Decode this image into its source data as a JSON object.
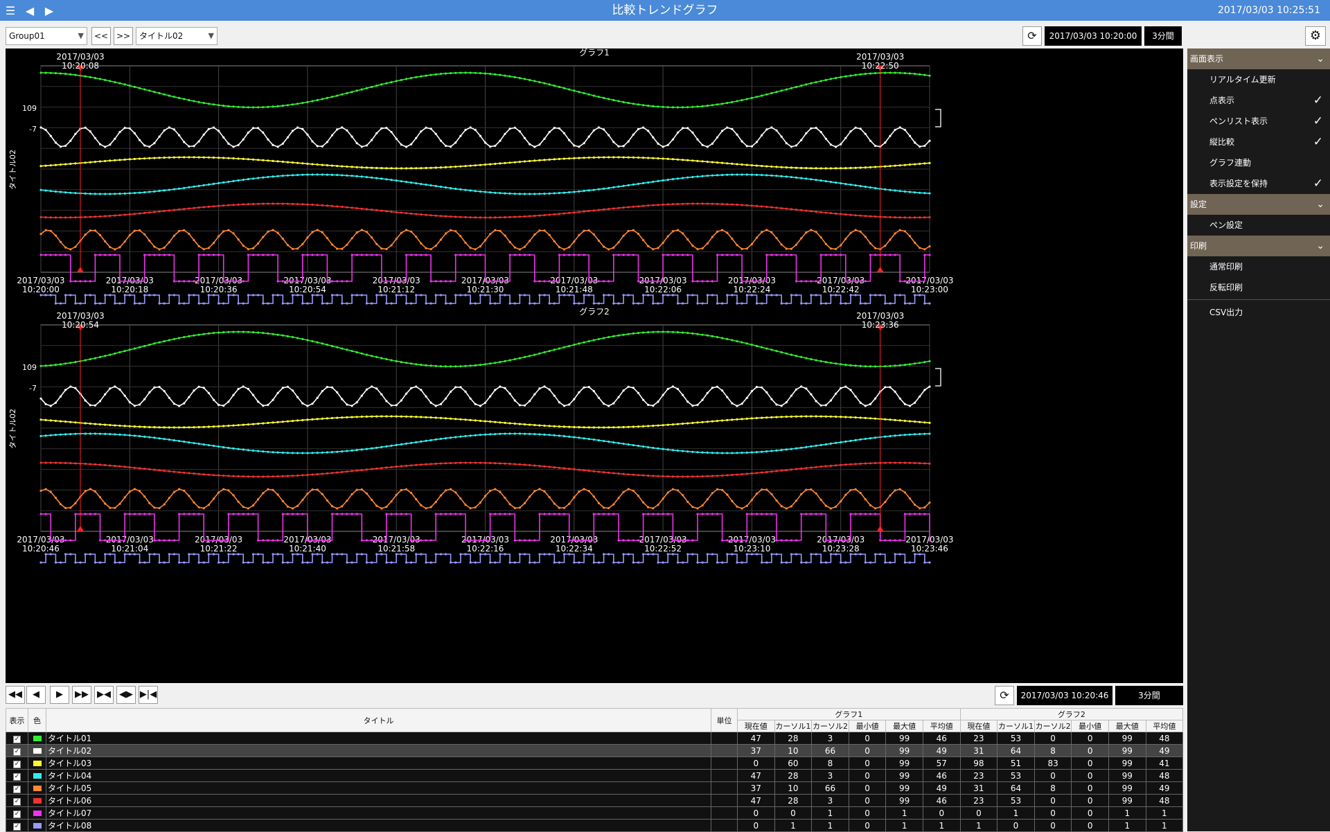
{
  "app": {
    "title": "比較トレンドグラフ",
    "clock": "2017/03/03 10:25:51"
  },
  "toolbar": {
    "group": "Group01",
    "prev": "<<",
    "next": ">>",
    "title_select": "タイトル02",
    "datetime": "2017/03/03 10:20:00",
    "span": "3分間"
  },
  "bottom": {
    "datetime": "2017/03/03 10:20:46",
    "span": "3分間"
  },
  "panel": {
    "sections": [
      {
        "label": "画面表示",
        "items": [
          {
            "label": "リアルタイム更新",
            "checked": false
          },
          {
            "label": "点表示",
            "checked": true
          },
          {
            "label": "ペンリスト表示",
            "checked": true
          },
          {
            "label": "縦比較",
            "checked": true
          },
          {
            "label": "グラフ連動",
            "checked": false
          },
          {
            "label": "表示設定を保持",
            "checked": true
          }
        ]
      },
      {
        "label": "設定",
        "items": [
          {
            "label": "ペン設定",
            "checked": false
          }
        ]
      },
      {
        "label": "印刷",
        "items": [
          {
            "label": "通常印刷",
            "checked": false
          },
          {
            "label": "反転印刷",
            "checked": false
          }
        ]
      }
    ],
    "csv": "CSV出力",
    "check_mark": "✓",
    "chevron": "⌄"
  },
  "chart_data": [
    {
      "type": "line",
      "title": "グラフ1",
      "ylabel": "タイトル02",
      "y_ticks": [
        "109",
        "-7"
      ],
      "x_ticks": [
        "2017/03/03|10:20:00",
        "2017/03/03|10:20:18",
        "2017/03/03|10:20:36",
        "2017/03/03|10:20:54",
        "2017/03/03|10:21:12",
        "2017/03/03|10:21:30",
        "2017/03/03|10:21:48",
        "2017/03/03|10:22:06",
        "2017/03/03|10:22:24",
        "2017/03/03|10:22:42",
        "2017/03/03|10:23:00"
      ],
      "cursors": [
        {
          "label": "2017/03/03|10:20:08",
          "t": 8
        },
        {
          "label": "2017/03/03|10:22:50",
          "t": 170
        }
      ],
      "x_range_seconds": [
        0,
        180
      ],
      "phase": 0
    },
    {
      "type": "line",
      "title": "グラフ2",
      "ylabel": "タイトル02",
      "y_ticks": [
        "109",
        "-7"
      ],
      "x_ticks": [
        "2017/03/03|10:20:46",
        "2017/03/03|10:21:04",
        "2017/03/03|10:21:22",
        "2017/03/03|10:21:40",
        "2017/03/03|10:21:58",
        "2017/03/03|10:22:16",
        "2017/03/03|10:22:34",
        "2017/03/03|10:22:52",
        "2017/03/03|10:23:10",
        "2017/03/03|10:23:28",
        "2017/03/03|10:23:46"
      ],
      "cursors": [
        {
          "label": "2017/03/03|10:20:54",
          "t": 8
        },
        {
          "label": "2017/03/03|10:23:36",
          "t": 170
        }
      ],
      "x_range_seconds": [
        0,
        180
      ],
      "phase": 46
    }
  ],
  "pens": [
    {
      "name": "タイトル01",
      "color": "#33ee33",
      "g1": [
        "47",
        "28",
        "3",
        "0",
        "99",
        "46"
      ],
      "g2": [
        "23",
        "53",
        "0",
        "0",
        "99",
        "48"
      ]
    },
    {
      "name": "タイトル02",
      "color": "#ffffff",
      "g1": [
        "37",
        "10",
        "66",
        "0",
        "99",
        "49"
      ],
      "g2": [
        "31",
        "64",
        "8",
        "0",
        "99",
        "49"
      ]
    },
    {
      "name": "タイトル03",
      "color": "#ffff33",
      "g1": [
        "0",
        "60",
        "8",
        "0",
        "99",
        "57"
      ],
      "g2": [
        "98",
        "51",
        "83",
        "0",
        "99",
        "41"
      ]
    },
    {
      "name": "タイトル04",
      "color": "#33eeee",
      "g1": [
        "47",
        "28",
        "3",
        "0",
        "99",
        "46"
      ],
      "g2": [
        "23",
        "53",
        "0",
        "0",
        "99",
        "48"
      ]
    },
    {
      "name": "タイトル05",
      "color": "#ff8833",
      "g1": [
        "37",
        "10",
        "66",
        "0",
        "99",
        "49"
      ],
      "g2": [
        "31",
        "64",
        "8",
        "0",
        "99",
        "49"
      ]
    },
    {
      "name": "タイトル06",
      "color": "#ee3333",
      "g1": [
        "47",
        "28",
        "3",
        "0",
        "99",
        "46"
      ],
      "g2": [
        "23",
        "53",
        "0",
        "0",
        "99",
        "48"
      ]
    },
    {
      "name": "タイトル07",
      "color": "#ee33ee",
      "g1": [
        "0",
        "0",
        "1",
        "0",
        "1",
        "0"
      ],
      "g2": [
        "0",
        "1",
        "0",
        "0",
        "1",
        "1"
      ]
    },
    {
      "name": "タイトル08",
      "color": "#9999ff",
      "g1": [
        "0",
        "1",
        "1",
        "0",
        "1",
        "1"
      ],
      "g2": [
        "1",
        "0",
        "0",
        "0",
        "1",
        "1"
      ]
    }
  ],
  "table": {
    "col_show": "表示",
    "col_color": "色",
    "col_title": "タイトル",
    "col_unit": "単位",
    "group1": "グラフ1",
    "group2": "グラフ2",
    "sub": [
      "現在値",
      "カーソル1",
      "カーソル2",
      "最小値",
      "最大値",
      "平均値"
    ]
  }
}
